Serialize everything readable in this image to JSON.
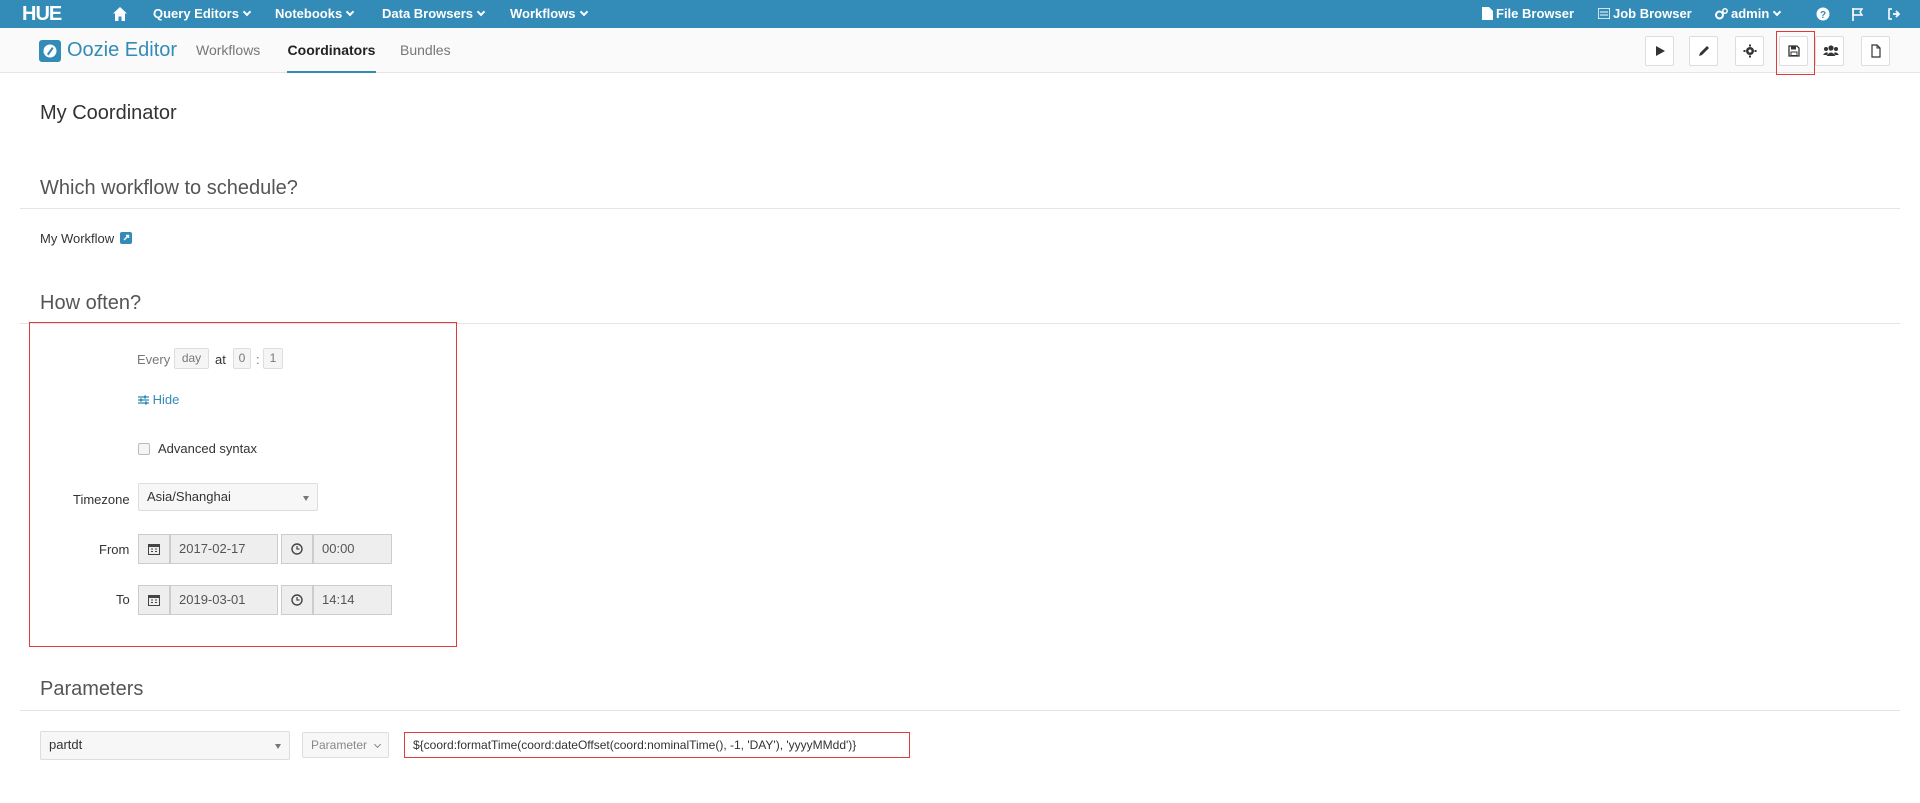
{
  "topbar": {
    "logo": "HUE",
    "menus": [
      {
        "label": "Query Editors"
      },
      {
        "label": "Notebooks"
      },
      {
        "label": "Data Browsers"
      },
      {
        "label": "Workflows"
      }
    ],
    "file_browser": "File Browser",
    "job_browser": "Job Browser",
    "user": "admin",
    "accent_color": "#338bb8"
  },
  "subbar": {
    "brand": "Oozie Editor",
    "tabs": [
      {
        "label": "Workflows"
      },
      {
        "label": "Coordinators"
      },
      {
        "label": "Bundles"
      }
    ]
  },
  "coordinator": {
    "name": "My Coordinator"
  },
  "schedule": {
    "heading": "Which workflow to schedule?",
    "workflow_name": "My Workflow"
  },
  "frequency": {
    "heading": "How often?",
    "every_label": "Every",
    "unit": "day",
    "at_label": "at",
    "hour": "0",
    "sep": ":",
    "minute": "1",
    "hide_label": "Hide",
    "advanced_label": "Advanced syntax",
    "timezone_label": "Timezone",
    "timezone_value": "Asia/Shanghai",
    "from_label": "From",
    "from_date": "2017-02-17",
    "from_time": "00:00",
    "to_label": "To",
    "to_date": "2019-03-01",
    "to_time": "14:14"
  },
  "parameters": {
    "heading": "Parameters",
    "name": "partdt",
    "type_label": "Parameter",
    "value": "${coord:formatTime(coord:dateOffset(coord:nominalTime(), -1, 'DAY'), 'yyyyMMdd')}"
  }
}
